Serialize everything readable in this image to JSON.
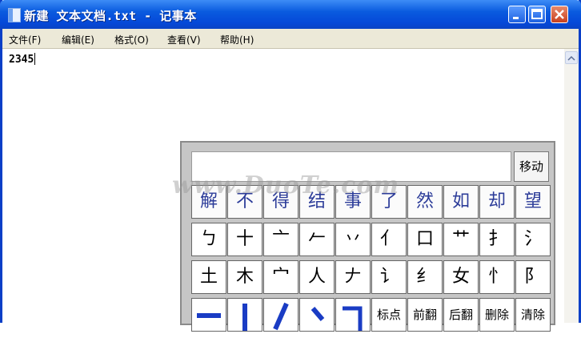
{
  "window": {
    "title": "新建 文本文档.txt - 记事本",
    "icon": "notepad-icon"
  },
  "title_buttons": [
    "minimize-icon",
    "maximize-icon",
    "close-icon"
  ],
  "menu": [
    {
      "label": "文件(F)"
    },
    {
      "label": "编辑(E)"
    },
    {
      "label": "格式(O)"
    },
    {
      "label": "查看(V)"
    },
    {
      "label": "帮助(H)"
    }
  ],
  "document": {
    "text": "2345"
  },
  "watermark": "www.DuoTe.com",
  "keyboard": {
    "move_label": "移动",
    "candidates": [
      "解",
      "不",
      "得",
      "结",
      "事",
      "了",
      "然",
      "如",
      "却",
      "望"
    ],
    "row2": [
      "ㄅ",
      "十",
      "亠",
      "𠂉",
      "丷",
      "亻",
      "口",
      "艹",
      "扌",
      "氵"
    ],
    "row3": [
      "土",
      "木",
      "宀",
      "人",
      "𠂇",
      "讠",
      "纟",
      "女",
      "忄",
      "阝"
    ],
    "row4_strokes": [
      "一",
      "丨",
      "丿",
      "丶",
      "乛"
    ],
    "row4_labels": [
      "标点",
      "前翻",
      "后翻",
      "删除",
      "清除"
    ]
  },
  "colors": {
    "titlebar": "#0a5bdf",
    "candidate_text": "#2c3c99",
    "stroke_blue": "#1a3cc4"
  }
}
